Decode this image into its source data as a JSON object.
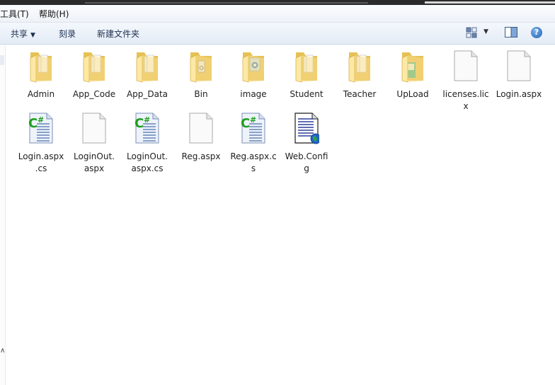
{
  "menu": {
    "tools": "工具(T)",
    "help": "帮助(H)"
  },
  "toolbar": {
    "share": "共享",
    "burn": "刻录",
    "new_folder": "新建文件夹",
    "help_glyph": "?"
  },
  "items": [
    {
      "name": "Admin",
      "line1": "Admin",
      "line2": "",
      "type": "folder",
      "icon": "folder-icon"
    },
    {
      "name": "App_Code",
      "line1": "App_Code",
      "line2": "",
      "type": "folder",
      "icon": "folder-icon"
    },
    {
      "name": "App_Data",
      "line1": "App_Data",
      "line2": "",
      "type": "folder",
      "icon": "folder-icon"
    },
    {
      "name": "Bin",
      "line1": "Bin",
      "line2": "",
      "type": "folder",
      "icon": "folder-bin-icon"
    },
    {
      "name": "image",
      "line1": "image",
      "line2": "",
      "type": "folder",
      "icon": "folder-image-icon"
    },
    {
      "name": "Student",
      "line1": "Student",
      "line2": "",
      "type": "folder",
      "icon": "folder-icon"
    },
    {
      "name": "Teacher",
      "line1": "Teacher",
      "line2": "",
      "type": "folder",
      "icon": "folder-icon"
    },
    {
      "name": "UpLoad",
      "line1": "UpLoad",
      "line2": "",
      "type": "folder",
      "icon": "folder-upload-icon"
    },
    {
      "name": "licenses.licx",
      "line1": "licenses.lic",
      "line2": "x",
      "type": "blank",
      "icon": "blank-file-icon"
    },
    {
      "name": "Login.aspx",
      "line1": "Login.aspx",
      "line2": "",
      "type": "blank",
      "icon": "blank-file-icon"
    },
    {
      "name": "Login.aspx.cs",
      "line1": "Login.aspx",
      "line2": ".cs",
      "type": "csharp",
      "icon": "csharp-file-icon"
    },
    {
      "name": "LoginOut.aspx",
      "line1": "LoginOut.",
      "line2": "aspx",
      "type": "blank",
      "icon": "blank-file-icon"
    },
    {
      "name": "LoginOut.aspx.cs",
      "line1": "LoginOut.",
      "line2": "aspx.cs",
      "type": "csharp",
      "icon": "csharp-file-icon"
    },
    {
      "name": "Reg.aspx",
      "line1": "Reg.aspx",
      "line2": "",
      "type": "blank",
      "icon": "blank-file-icon"
    },
    {
      "name": "Reg.aspx.cs",
      "line1": "Reg.aspx.c",
      "line2": "s",
      "type": "csharp",
      "icon": "csharp-file-icon"
    },
    {
      "name": "Web.Config",
      "line1": "Web.Confi",
      "line2": "g",
      "type": "config",
      "icon": "config-file-icon"
    }
  ],
  "colors": {
    "folder_light": "#fde9a4",
    "folder_dark": "#e6c154",
    "csharp_green": "#1f9e1f",
    "toolbar_top": "#f4f8fd",
    "toolbar_bottom": "#e4ebf5"
  }
}
